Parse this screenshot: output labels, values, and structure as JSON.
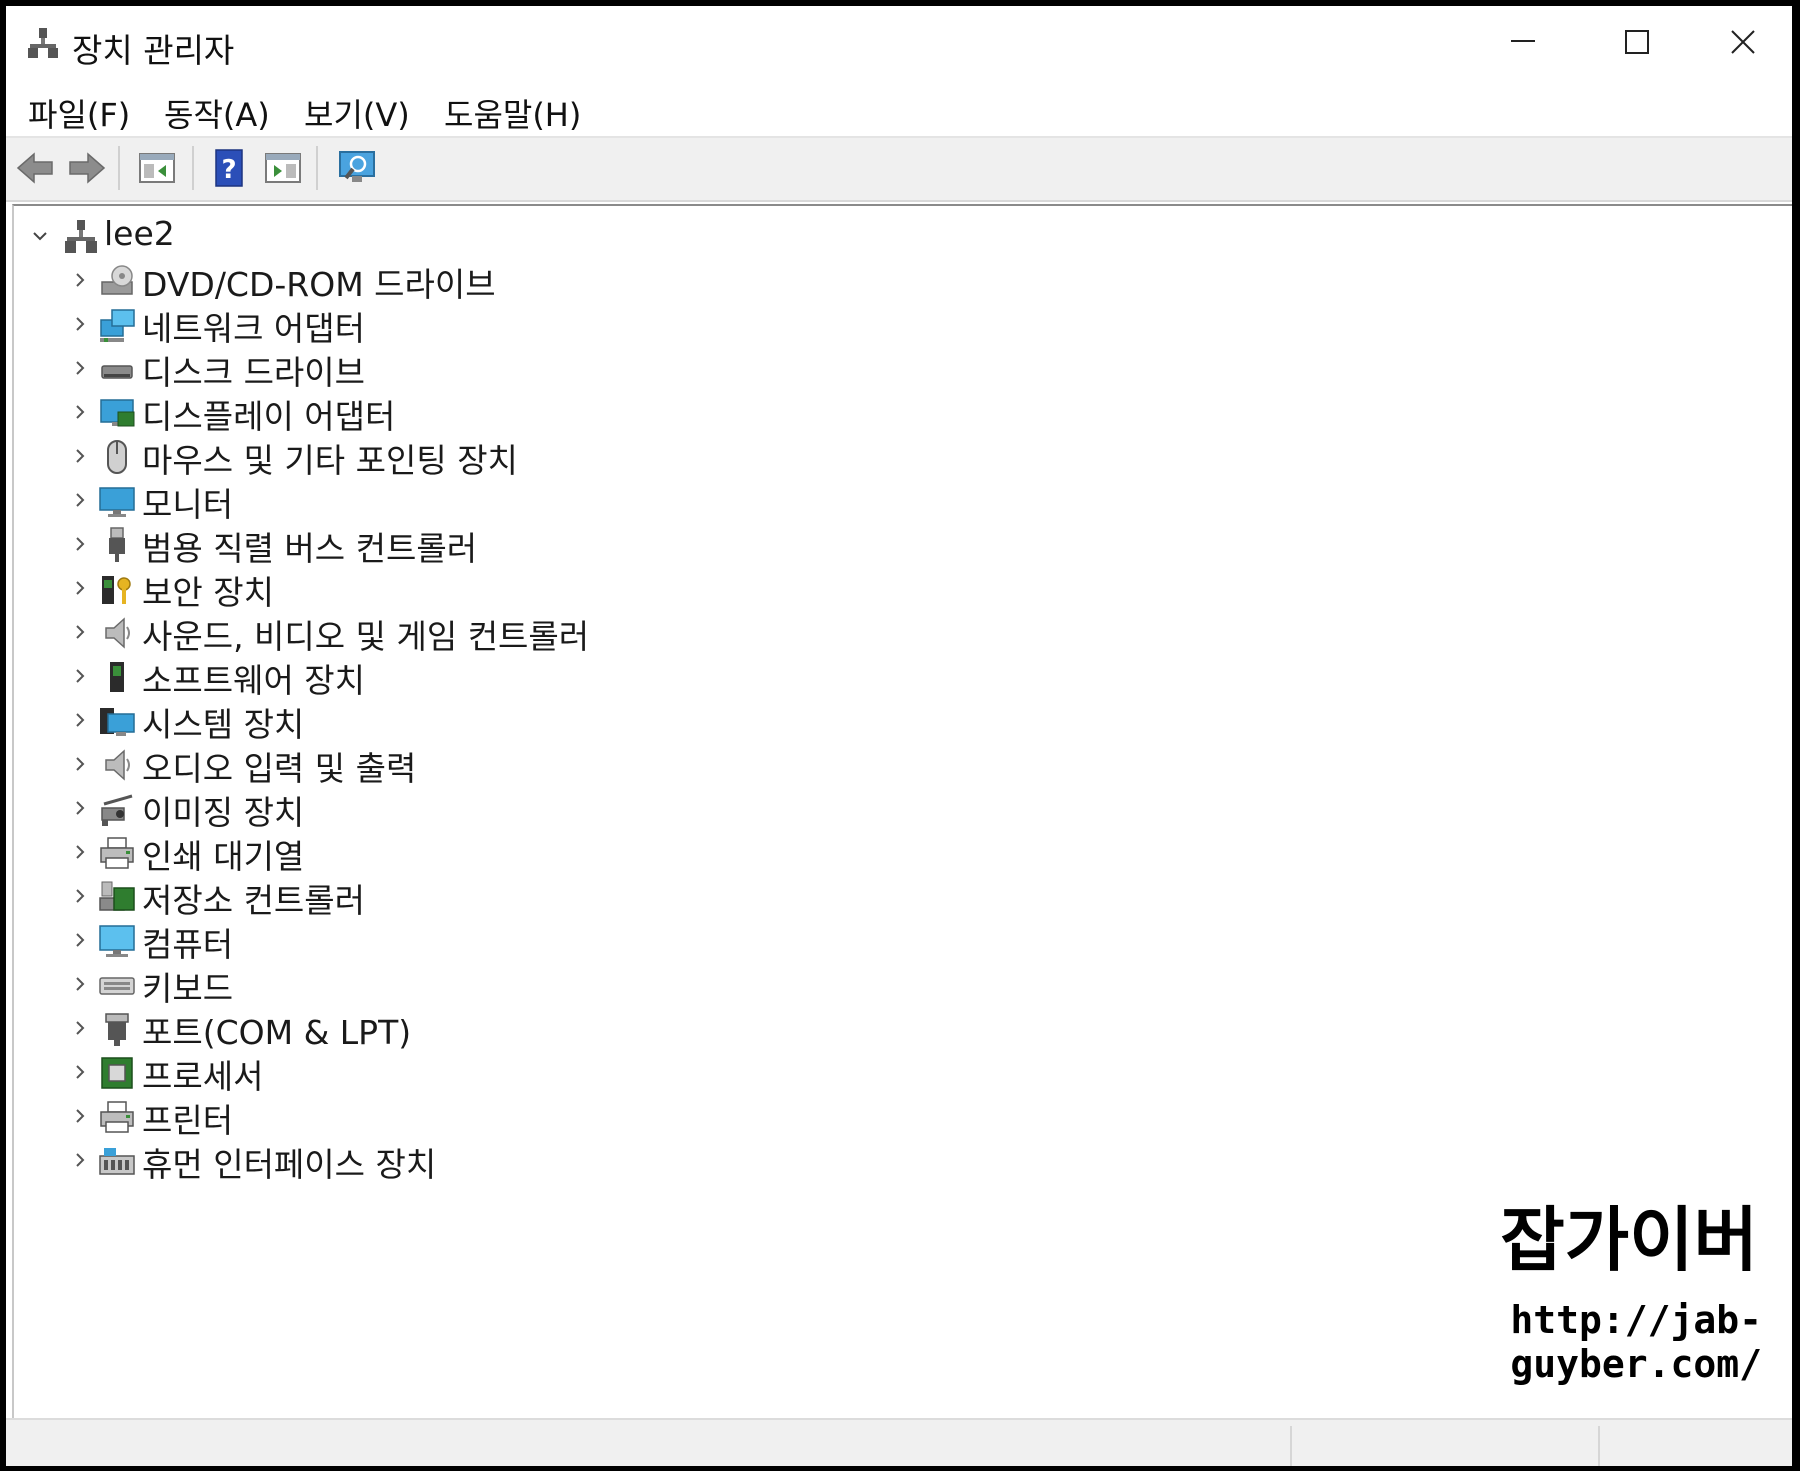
{
  "window": {
    "title": "장치 관리자"
  },
  "menu": [
    {
      "label": "파일(F)"
    },
    {
      "label": "동작(A)"
    },
    {
      "label": "보기(V)"
    },
    {
      "label": "도움말(H)"
    }
  ],
  "toolbar": {
    "buttons": [
      "back-arrow-icon",
      "forward-arrow-icon",
      "show-hide-console-tree-icon",
      "help-icon",
      "action-pane-icon",
      "scan-hardware-icon"
    ]
  },
  "tree": {
    "root": {
      "label": "lee2",
      "expanded": true
    },
    "categories": [
      {
        "label": "DVD/CD-ROM 드라이브",
        "icon": "dvd-drive-icon"
      },
      {
        "label": "네트워크 어댑터",
        "icon": "network-adapter-icon"
      },
      {
        "label": "디스크 드라이브",
        "icon": "disk-drive-icon"
      },
      {
        "label": "디스플레이 어댑터",
        "icon": "display-adapter-icon"
      },
      {
        "label": "마우스 및 기타 포인팅 장치",
        "icon": "mouse-icon"
      },
      {
        "label": "모니터",
        "icon": "monitor-icon"
      },
      {
        "label": "범용 직렬 버스 컨트롤러",
        "icon": "usb-icon"
      },
      {
        "label": "보안 장치",
        "icon": "security-device-icon"
      },
      {
        "label": "사운드, 비디오 및 게임 컨트롤러",
        "icon": "speaker-icon"
      },
      {
        "label": "소프트웨어 장치",
        "icon": "software-device-icon"
      },
      {
        "label": "시스템 장치",
        "icon": "system-device-icon"
      },
      {
        "label": "오디오 입력 및 출력",
        "icon": "speaker-icon"
      },
      {
        "label": "이미징 장치",
        "icon": "camera-icon"
      },
      {
        "label": "인쇄 대기열",
        "icon": "printer-icon"
      },
      {
        "label": "저장소 컨트롤러",
        "icon": "storage-controller-icon"
      },
      {
        "label": "컴퓨터",
        "icon": "computer-icon"
      },
      {
        "label": "키보드",
        "icon": "keyboard-icon"
      },
      {
        "label": "포트(COM & LPT)",
        "icon": "port-icon"
      },
      {
        "label": "프로세서",
        "icon": "processor-icon"
      },
      {
        "label": "프린터",
        "icon": "printer-icon"
      },
      {
        "label": "휴먼 인터페이스 장치",
        "icon": "hid-icon"
      }
    ]
  },
  "watermark": {
    "title": "잡가이버",
    "url": "http://jab-guyber.com/"
  }
}
